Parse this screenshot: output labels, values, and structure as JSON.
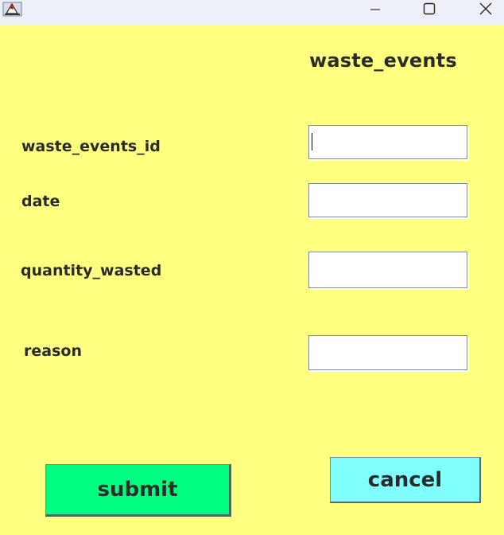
{
  "window": {
    "icon": "java-duke-icon",
    "controls": [
      "minimize-icon",
      "maximize-icon",
      "close-icon"
    ]
  },
  "form": {
    "title": "waste_events",
    "fields": [
      {
        "label": "waste_events_id",
        "value": ""
      },
      {
        "label": "date",
        "value": ""
      },
      {
        "label": "quantity_wasted",
        "value": ""
      },
      {
        "label": "reason",
        "value": ""
      }
    ]
  },
  "buttons": {
    "submit": "submit",
    "cancel": "cancel"
  },
  "colors": {
    "background": "#ffff80",
    "submit": "#00ff80",
    "cancel": "#80ffff",
    "titlebar": "#eef0f8"
  }
}
